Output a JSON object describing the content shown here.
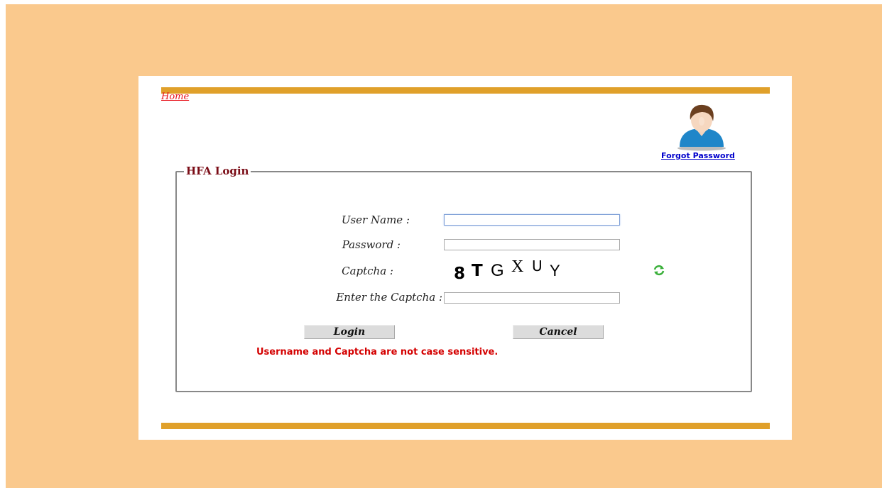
{
  "nav": {
    "home_label": "Home"
  },
  "links": {
    "forgot_password": "Forgot Password"
  },
  "login": {
    "legend": "HFA Login",
    "username_label": "User Name :",
    "password_label": "Password :",
    "captcha_label": "Captcha :",
    "enter_captcha_label": "Enter the Captcha :",
    "username_value": "",
    "password_value": "",
    "captcha_input_value": "",
    "captcha_chars": [
      "8",
      "T",
      "G",
      "X",
      "U",
      "Y"
    ],
    "login_button": "Login",
    "cancel_button": "Cancel",
    "note": "Username and Captcha are not case sensitive."
  },
  "icons": {
    "avatar": "user-avatar-icon",
    "refresh": "refresh-icon"
  },
  "colors": {
    "page_background": "#fac98d",
    "accent_bar": "#e0a02a",
    "note_text": "#d40000",
    "legend_text": "#7a0c16",
    "home_link": "#e8111a",
    "forgot_link": "#0000cc"
  }
}
